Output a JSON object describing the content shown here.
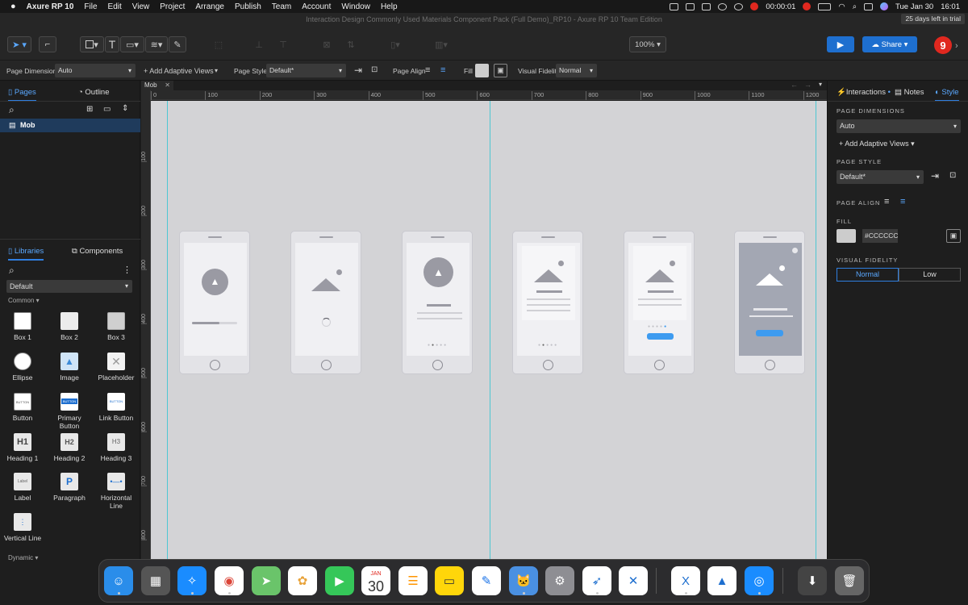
{
  "menubar": {
    "apple": "",
    "app_name": "Axure RP 10",
    "items": [
      "File",
      "Edit",
      "View",
      "Project",
      "Arrange",
      "Publish",
      "Team",
      "Account",
      "Window",
      "Help"
    ],
    "recording_time": "00:00:01",
    "date": "Tue Jan 30",
    "time": "16:01"
  },
  "window": {
    "title": "Interaction Design Commonly Used Materials Component Pack (Full Demo)_RP10 - Axure RP 10 Team Edition",
    "trial": "25 days left in trial"
  },
  "toolbar": {
    "zoom": "100%",
    "share_label": "Share",
    "avatar_count": "9",
    "text_tool": "T"
  },
  "propbar": {
    "page_dimensions_label": "Page Dimensions",
    "page_dimensions_value": "Auto",
    "add_adaptive_views": "+ Add Adaptive Views",
    "page_style_label": "Page Style",
    "page_style_value": "Default*",
    "page_align_label": "Page Align",
    "fill_label": "Fill",
    "visual_fidelity_label": "Visual Fidelity",
    "visual_fidelity_value": "Normal"
  },
  "left_panel": {
    "tabs": [
      "Pages",
      "Outline"
    ],
    "pages": [
      "Mob"
    ],
    "lib_tabs": [
      "Libraries",
      "Components"
    ],
    "library_select": "Default",
    "section": "Common",
    "items": [
      "Box 1",
      "Box 2",
      "Box 3",
      "Ellipse",
      "Image",
      "Placeholder",
      "Button",
      "Primary Button",
      "Link Button",
      "Heading 1",
      "Heading 2",
      "Heading 3",
      "Label",
      "Paragraph",
      "Horizontal Line",
      "Vertical Line"
    ],
    "icon_texts": {
      "h1": "H1",
      "h2": "H2",
      "h3": "H3",
      "label": "Label",
      "p": "P",
      "button": "BUTTON"
    },
    "bottom_section": "Dynamic"
  },
  "canvas": {
    "doc_tab": "Mob",
    "ruler_h": [
      "0",
      "100",
      "200",
      "300",
      "400",
      "500",
      "600",
      "700",
      "800",
      "900",
      "1000",
      "1100",
      "1200"
    ],
    "ruler_v": [
      "100",
      "200",
      "300",
      "400",
      "500",
      "600",
      "700",
      "800"
    ]
  },
  "right_panel": {
    "tabs": [
      "Interactions",
      "Notes",
      "Style"
    ],
    "page_dimensions_heading": "PAGE DIMENSIONS",
    "page_dimensions_value": "Auto",
    "add_adaptive_views": "+ Add Adaptive Views",
    "page_style_heading": "PAGE STYLE",
    "page_style_value": "Default*",
    "page_align_heading": "PAGE ALIGN",
    "fill_heading": "FILL",
    "fill_value": "#CCCCCC",
    "visual_fidelity_heading": "VISUAL FIDELITY",
    "fidelity_options": [
      "Normal",
      "Low"
    ]
  },
  "dock": {
    "calendar_month": "JAN",
    "calendar_day": "30"
  },
  "colors": {
    "accent": "#2f7fe0",
    "guide": "#4ec7d3",
    "canvas": "#d3d3d6",
    "fill_swatch": "#cccccc",
    "cta": "#3d9bf0"
  }
}
